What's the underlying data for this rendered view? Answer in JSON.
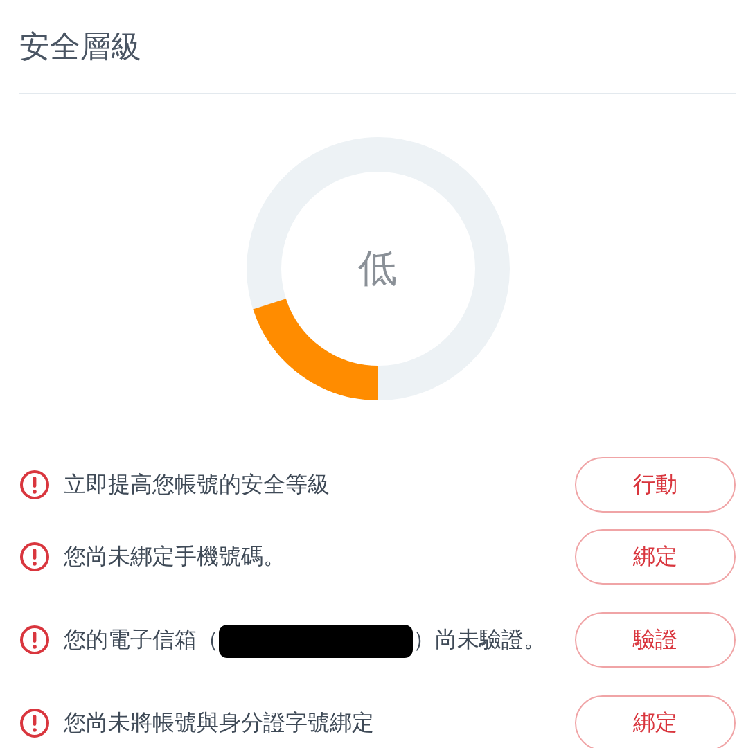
{
  "title": "安全層級",
  "meter": {
    "label": "低",
    "level": 0.2
  },
  "items": [
    {
      "kind": "plain",
      "text": "立即提高您帳號的安全等級",
      "button": "行動"
    },
    {
      "kind": "plain",
      "text": "您尚未綁定手機號碼。",
      "button": "綁定"
    },
    {
      "kind": "redacted",
      "prefix": "您的電子信箱（",
      "suffix": "）尚未驗證。",
      "button": "驗證"
    },
    {
      "kind": "plain",
      "text": "您尚未將帳號與身分證字號綁定",
      "button": "綁定"
    }
  ]
}
